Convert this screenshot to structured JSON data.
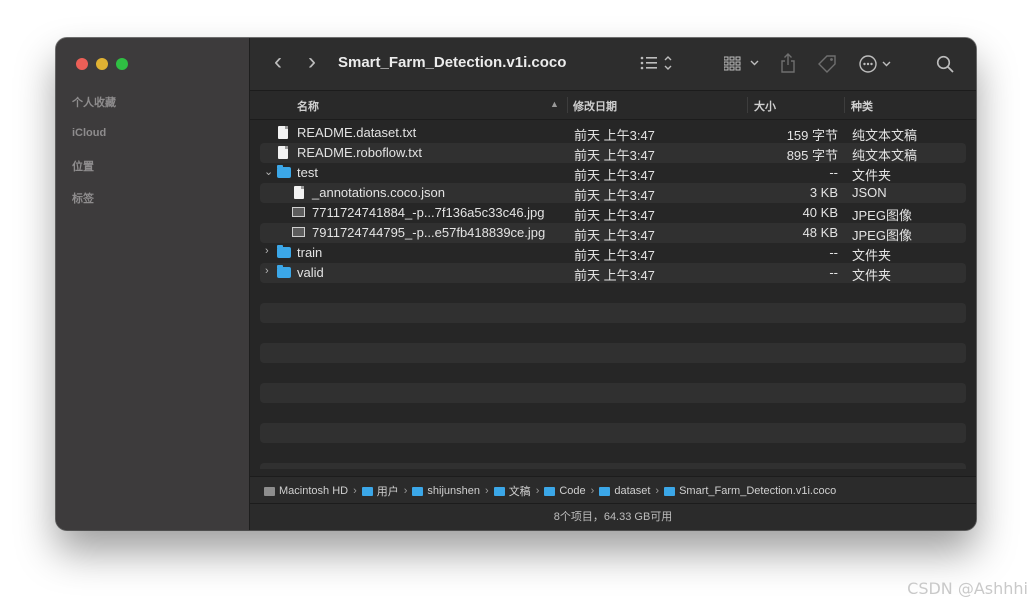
{
  "window": {
    "title": "Smart_Farm_Detection.v1i.coco"
  },
  "sidebar": {
    "items": [
      {
        "label": "个人收藏"
      },
      {
        "label": "iCloud"
      },
      {
        "label": "位置"
      },
      {
        "label": "标签"
      }
    ]
  },
  "toolbar": {
    "icons": [
      "back-icon",
      "forward-icon",
      "list-view-icon",
      "grid-view-icon",
      "share-icon",
      "tag-icon",
      "more-icon",
      "search-icon"
    ],
    "back": "‹",
    "forward": "›"
  },
  "columns": {
    "name": "名称",
    "date": "修改日期",
    "size": "大小",
    "kind": "种类"
  },
  "files": [
    {
      "name": "README.dataset.txt",
      "date": "前天 上午3:47",
      "size": "159 字节",
      "kind": "纯文本文稿",
      "type": "file",
      "level": 0
    },
    {
      "name": "README.roboflow.txt",
      "date": "前天 上午3:47",
      "size": "895 字节",
      "kind": "纯文本文稿",
      "type": "file",
      "level": 0
    },
    {
      "name": "test",
      "date": "前天 上午3:47",
      "size": "--",
      "kind": "文件夹",
      "type": "folder",
      "level": 0,
      "expanded": true
    },
    {
      "name": "_annotations.coco.json",
      "date": "前天 上午3:47",
      "size": "3 KB",
      "kind": "JSON",
      "type": "file",
      "level": 1
    },
    {
      "name": "7711724741884_-p...7f136a5c33c46.jpg",
      "date": "前天 上午3:47",
      "size": "40 KB",
      "kind": "JPEG图像",
      "type": "image",
      "level": 1
    },
    {
      "name": "7911724744795_-p...e57fb418839ce.jpg",
      "date": "前天 上午3:47",
      "size": "48 KB",
      "kind": "JPEG图像",
      "type": "image",
      "level": 1
    },
    {
      "name": "train",
      "date": "前天 上午3:47",
      "size": "--",
      "kind": "文件夹",
      "type": "folder",
      "level": 0,
      "expanded": false
    },
    {
      "name": "valid",
      "date": "前天 上午3:47",
      "size": "--",
      "kind": "文件夹",
      "type": "folder",
      "level": 0,
      "expanded": false
    }
  ],
  "path": [
    {
      "label": "Macintosh HD",
      "icon": "disk-icon"
    },
    {
      "label": "用户",
      "icon": "folder-icon"
    },
    {
      "label": "shijunshen",
      "icon": "folder-icon"
    },
    {
      "label": "文稿",
      "icon": "folder-icon"
    },
    {
      "label": "Code",
      "icon": "folder-icon"
    },
    {
      "label": "dataset",
      "icon": "folder-icon"
    },
    {
      "label": "Smart_Farm_Detection.v1i.coco",
      "icon": "folder-icon"
    }
  ],
  "status": {
    "text": "8个项目，64.33 GB可用"
  },
  "watermark": "CSDN @Ashhhi"
}
